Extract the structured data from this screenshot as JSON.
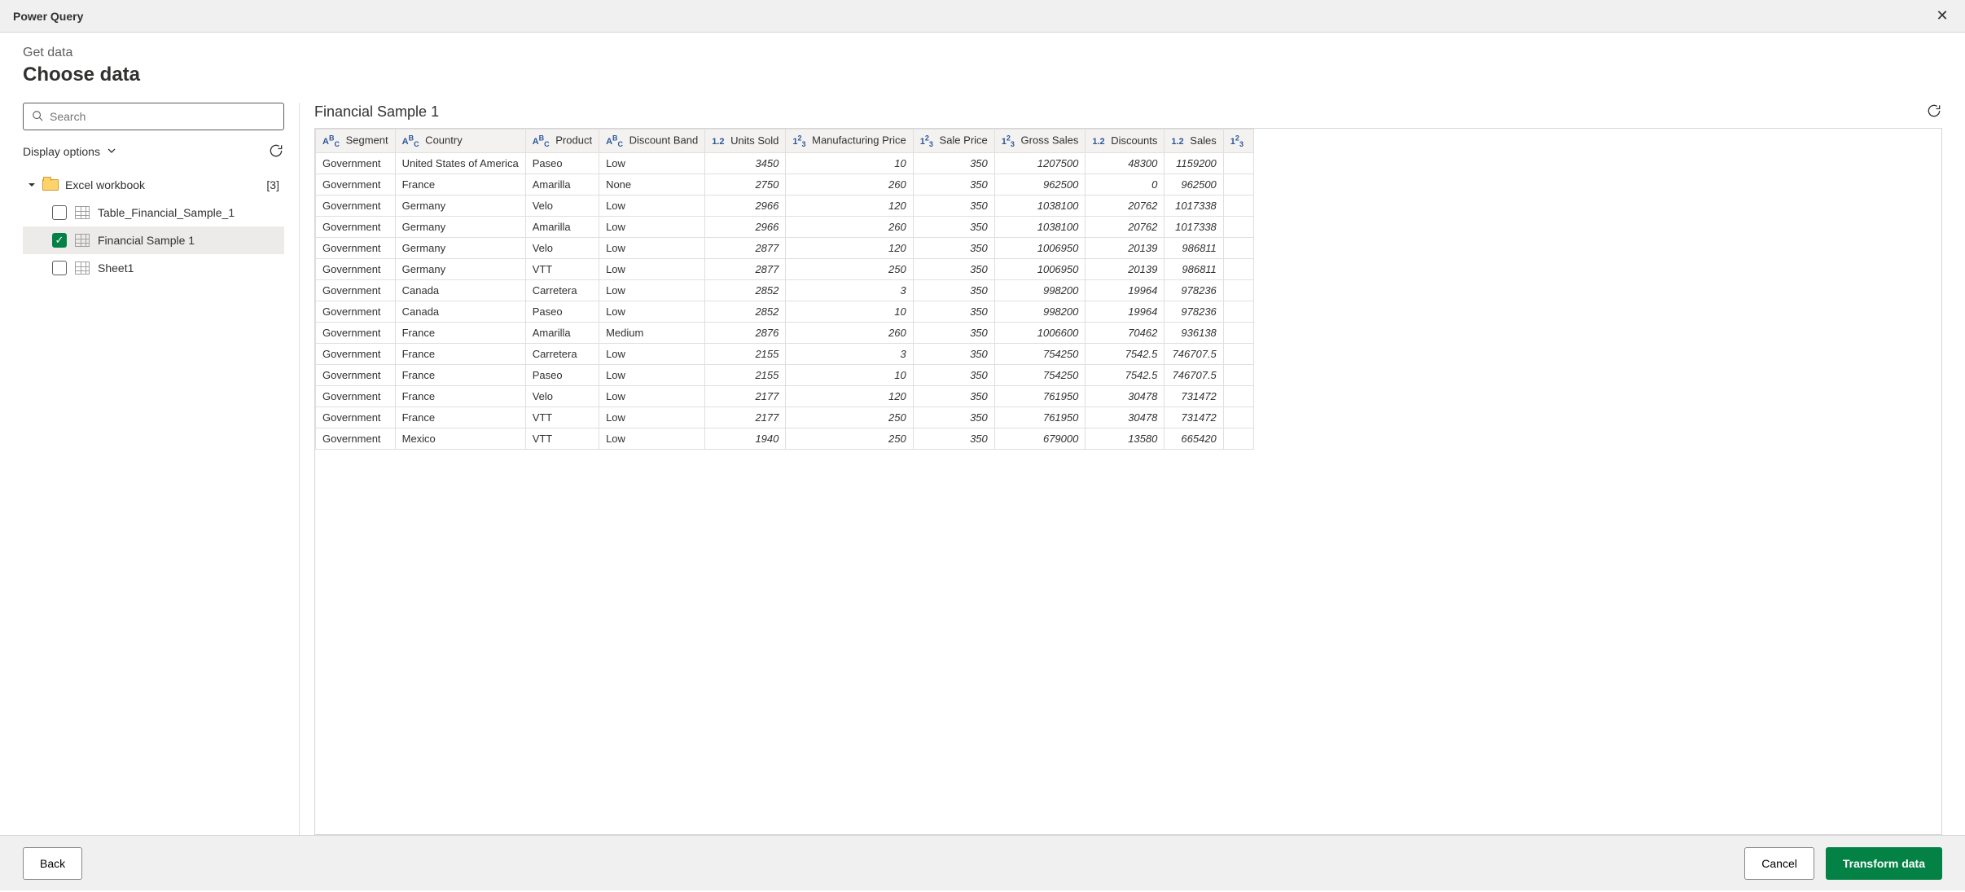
{
  "window": {
    "title": "Power Query"
  },
  "header": {
    "breadcrumb": "Get data",
    "page_title": "Choose data"
  },
  "sidebar": {
    "search_placeholder": "Search",
    "display_options": "Display options",
    "folder": {
      "label": "Excel workbook",
      "count": "[3]"
    },
    "items": [
      {
        "label": "Table_Financial_Sample_1",
        "checked": false
      },
      {
        "label": "Financial Sample 1",
        "checked": true
      },
      {
        "label": "Sheet1",
        "checked": false
      }
    ]
  },
  "preview": {
    "title": "Financial Sample 1",
    "columns": [
      {
        "name": "Segment",
        "type": "text"
      },
      {
        "name": "Country",
        "type": "text"
      },
      {
        "name": "Product",
        "type": "text"
      },
      {
        "name": "Discount Band",
        "type": "text"
      },
      {
        "name": "Units Sold",
        "type": "decimal"
      },
      {
        "name": "Manufacturing Price",
        "type": "int"
      },
      {
        "name": "Sale Price",
        "type": "int"
      },
      {
        "name": "Gross Sales",
        "type": "int"
      },
      {
        "name": "Discounts",
        "type": "decimal"
      },
      {
        "name": "Sales",
        "type": "decimal"
      }
    ],
    "rows": [
      [
        "Government",
        "United States of America",
        "Paseo",
        "Low",
        "3450",
        "10",
        "350",
        "1207500",
        "48300",
        "1159200"
      ],
      [
        "Government",
        "France",
        "Amarilla",
        "None",
        "2750",
        "260",
        "350",
        "962500",
        "0",
        "962500"
      ],
      [
        "Government",
        "Germany",
        "Velo",
        "Low",
        "2966",
        "120",
        "350",
        "1038100",
        "20762",
        "1017338"
      ],
      [
        "Government",
        "Germany",
        "Amarilla",
        "Low",
        "2966",
        "260",
        "350",
        "1038100",
        "20762",
        "1017338"
      ],
      [
        "Government",
        "Germany",
        "Velo",
        "Low",
        "2877",
        "120",
        "350",
        "1006950",
        "20139",
        "986811"
      ],
      [
        "Government",
        "Germany",
        "VTT",
        "Low",
        "2877",
        "250",
        "350",
        "1006950",
        "20139",
        "986811"
      ],
      [
        "Government",
        "Canada",
        "Carretera",
        "Low",
        "2852",
        "3",
        "350",
        "998200",
        "19964",
        "978236"
      ],
      [
        "Government",
        "Canada",
        "Paseo",
        "Low",
        "2852",
        "10",
        "350",
        "998200",
        "19964",
        "978236"
      ],
      [
        "Government",
        "France",
        "Amarilla",
        "Medium",
        "2876",
        "260",
        "350",
        "1006600",
        "70462",
        "936138"
      ],
      [
        "Government",
        "France",
        "Carretera",
        "Low",
        "2155",
        "3",
        "350",
        "754250",
        "7542.5",
        "746707.5"
      ],
      [
        "Government",
        "France",
        "Paseo",
        "Low",
        "2155",
        "10",
        "350",
        "754250",
        "7542.5",
        "746707.5"
      ],
      [
        "Government",
        "France",
        "Velo",
        "Low",
        "2177",
        "120",
        "350",
        "761950",
        "30478",
        "731472"
      ],
      [
        "Government",
        "France",
        "VTT",
        "Low",
        "2177",
        "250",
        "350",
        "761950",
        "30478",
        "731472"
      ],
      [
        "Government",
        "Mexico",
        "VTT",
        "Low",
        "1940",
        "250",
        "350",
        "679000",
        "13580",
        "665420"
      ]
    ]
  },
  "footer": {
    "back": "Back",
    "cancel": "Cancel",
    "transform": "Transform data"
  }
}
